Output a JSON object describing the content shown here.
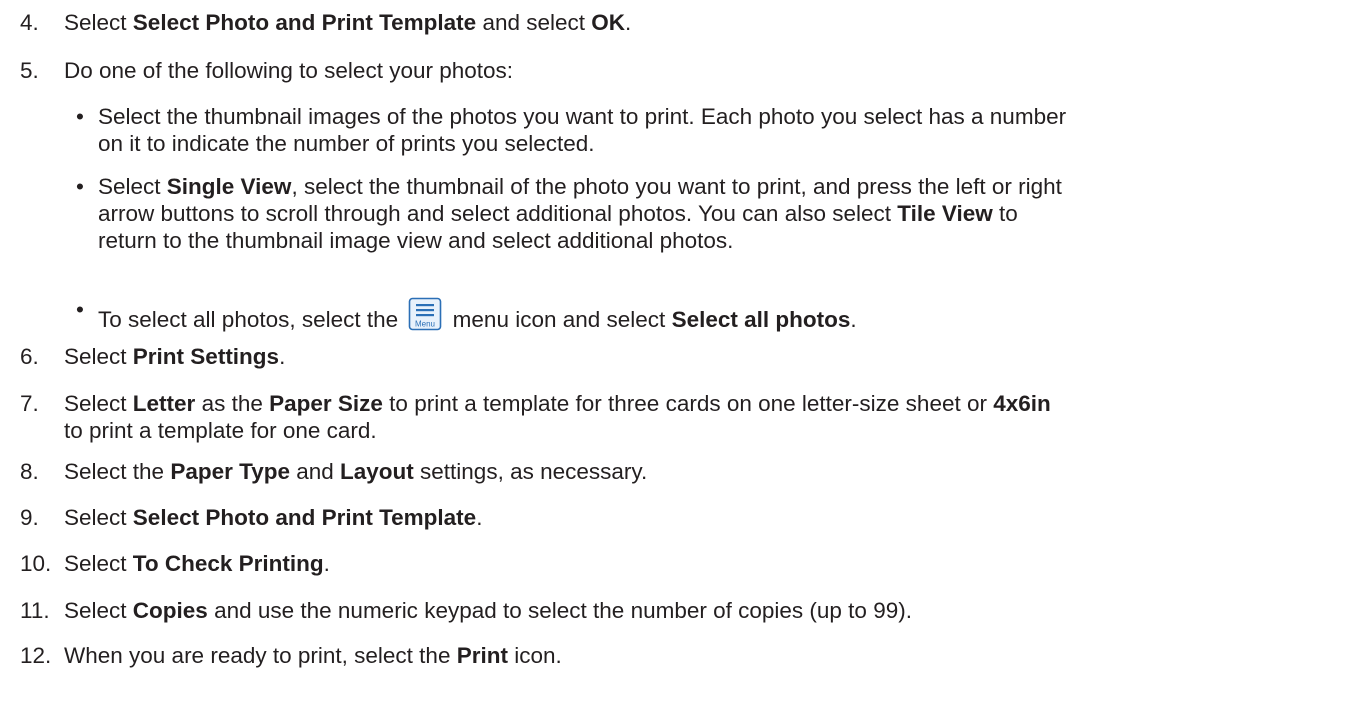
{
  "steps": [
    {
      "number": "4.",
      "parts": [
        "Select ",
        "Select Photo and Print Template",
        " and select ",
        "OK",
        "."
      ]
    },
    {
      "number": "5.",
      "parts": [
        "Do one of the following to select your photos:"
      ],
      "bullets": [
        {
          "marker": "•",
          "line1": "Select the thumbnail images of the photos you want to print. Each photo you select has a number",
          "line2": "on it to indicate the number of prints you selected."
        },
        {
          "marker": "•",
          "l1a": "Select ",
          "l1b": "Single View",
          "l1c": ", select the thumbnail of the photo you want to print, and press the left or right",
          "l2a": "arrow buttons to scroll through and select additional photos. You can also select ",
          "l2b": "Tile View",
          "l2c": " to",
          "l3": "return to the thumbnail image view and select additional photos."
        },
        {
          "marker": "•",
          "a": "To select all photos, select the ",
          "icon_label": "Menu",
          "icon_name": "menu-icon",
          "b": " menu icon and select ",
          "c": "Select all photos",
          "d": "."
        }
      ]
    },
    {
      "number": "6.",
      "parts": [
        "Select ",
        "Print Settings",
        "."
      ]
    },
    {
      "number": "7.",
      "l1a": "Select ",
      "l1b": "Letter",
      "l1c": " as the ",
      "l1d": "Paper Size",
      "l1e": " to print a template for three cards on one letter-size sheet or ",
      "l1f": "4x6in",
      "l2": "to print a template for one card."
    },
    {
      "number": "8.",
      "parts": [
        "Select the ",
        "Paper Type",
        " and ",
        "Layout",
        " settings, as necessary."
      ]
    },
    {
      "number": "9.",
      "parts": [
        "Select ",
        "Select Photo and Print Template",
        "."
      ]
    },
    {
      "number": "10.",
      "parts": [
        "Select ",
        "To Check Printing",
        "."
      ]
    },
    {
      "number": "11.",
      "parts": [
        "Select ",
        "Copies",
        " and use the numeric keypad to select the number of copies (up to 99)."
      ]
    },
    {
      "number": "12.",
      "parts": [
        "When you are ready to print, select the ",
        "Print",
        " icon."
      ]
    }
  ],
  "colors": {
    "text": "#231f20",
    "icon_blue": "#2b6fb6",
    "icon_fill": "#e8f1fb"
  }
}
